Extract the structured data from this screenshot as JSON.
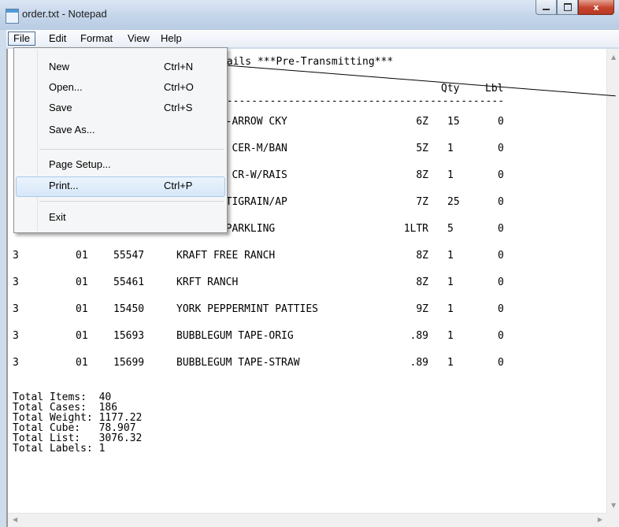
{
  "window": {
    "title": "order.txt - Notepad",
    "close_glyph": "x"
  },
  "menubar": [
    "File",
    "Edit",
    "Format",
    "View",
    "Help"
  ],
  "file_menu": [
    {
      "label": "New",
      "shortcut": "Ctrl+N"
    },
    {
      "label": "Open...",
      "shortcut": "Ctrl+O"
    },
    {
      "label": "Save",
      "shortcut": "Ctrl+S"
    },
    {
      "label": "Save As...",
      "shortcut": ""
    },
    {
      "label": "Page Setup...",
      "shortcut": ""
    },
    {
      "label": "Print...",
      "shortcut": "Ctrl+P"
    },
    {
      "label": "Exit",
      "shortcut": ""
    }
  ],
  "document": {
    "header_line": "tails ***Pre-Transmitting***",
    "col_qty": "Qty",
    "col_lbl": "Lbl",
    "divider": "----------------------------------------------",
    "rows": [
      {
        "a": "",
        "b": "",
        "c": "",
        "desc": "ETS GROW-ARROW CKY",
        "size": "6Z",
        "qty": "15",
        "lbl": "0"
      },
      {
        "a": "",
        "b": "",
        "c": "",
        "desc": "ETS GROW CER-M/BAN",
        "size": "5Z",
        "qty": "1",
        "lbl": "0"
      },
      {
        "a": "",
        "b": "",
        "c": "",
        "desc": "2 GD EVE CR-W/RAIS",
        "size": "8Z",
        "qty": "1",
        "lbl": "0"
      },
      {
        "a": "",
        "b": "",
        "c": "",
        "desc": "-DHA+MULTIGRAIN/AP",
        "size": "7Z",
        "qty": "25",
        "lbl": "0"
      },
      {
        "a": "",
        "b": "",
        "c": "",
        "desc": "LLGRNO SPARKLING",
        "size": "1LTR",
        "qty": "5",
        "lbl": "0"
      },
      {
        "a": "3",
        "b": "01",
        "c": "55547",
        "desc": "KRAFT FREE RANCH",
        "size": "8Z",
        "qty": "1",
        "lbl": "0"
      },
      {
        "a": "3",
        "b": "01",
        "c": "55461",
        "desc": "KRFT RANCH",
        "size": "8Z",
        "qty": "1",
        "lbl": "0"
      },
      {
        "a": "3",
        "b": "01",
        "c": "15450",
        "desc": "YORK PEPPERMINT PATTIES",
        "size": "9Z",
        "qty": "1",
        "lbl": "0"
      },
      {
        "a": "3",
        "b": "01",
        "c": "15693",
        "desc": "BUBBLEGUM TAPE-ORIG",
        "size": ".89",
        "qty": "1",
        "lbl": "0"
      },
      {
        "a": "3",
        "b": "01",
        "c": "15699",
        "desc": "BUBBLEGUM TAPE-STRAW",
        "size": ".89",
        "qty": "1",
        "lbl": "0"
      }
    ],
    "totals": [
      "Total Items:  40",
      "Total Cases:  186",
      "Total Weight: 1177.22",
      "Total Cube:   78.907",
      "Total List:   3076.32",
      "Total Labels: 1"
    ]
  }
}
